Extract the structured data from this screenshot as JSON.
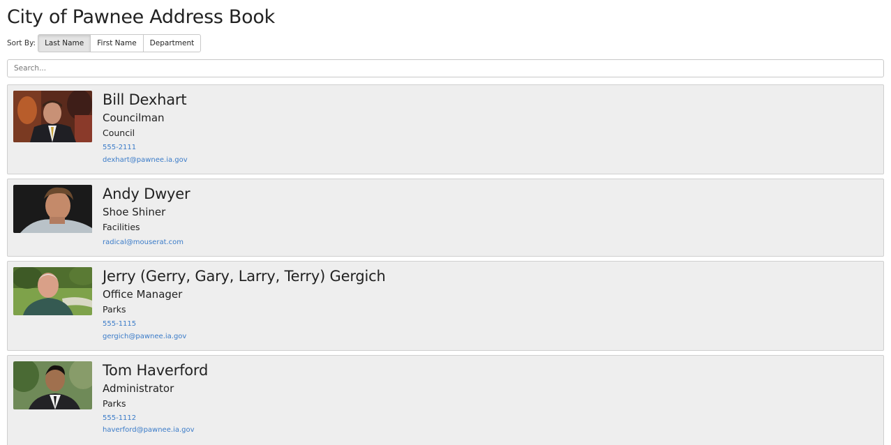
{
  "page": {
    "title": "City of Pawnee Address Book"
  },
  "sort": {
    "label": "Sort By:",
    "options": [
      "Last Name",
      "First Name",
      "Department"
    ],
    "active": "Last Name"
  },
  "search": {
    "placeholder": "Search..."
  },
  "contacts": [
    {
      "name": "Bill Dexhart",
      "title": "Councilman",
      "department": "Council",
      "phone": "555-2111",
      "email": "dexhart@pawnee.ia.gov"
    },
    {
      "name": "Andy Dwyer",
      "title": "Shoe Shiner",
      "department": "Facilities",
      "email": "radical@mouserat.com"
    },
    {
      "name": "Jerry (Gerry, Gary, Larry, Terry) Gergich",
      "title": "Office Manager",
      "department": "Parks",
      "phone": "555-1115",
      "email": "gergich@pawnee.ia.gov"
    },
    {
      "name": "Tom Haverford",
      "title": "Administrator",
      "department": "Parks",
      "phone": "555-1112",
      "email": "haverford@pawnee.ia.gov"
    }
  ],
  "colors": {
    "card_background": "#eeeeee",
    "link": "#3a7bc8",
    "active_button": "#e4e4e4"
  }
}
